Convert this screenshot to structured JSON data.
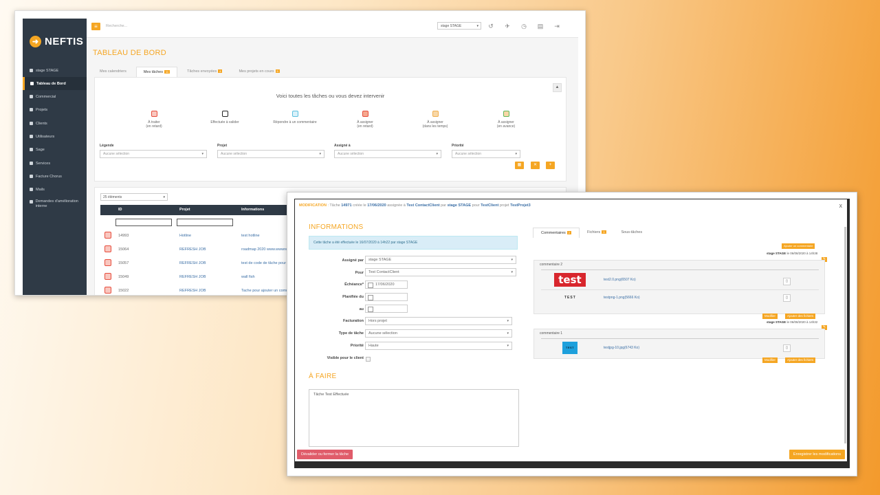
{
  "back": {
    "logo_mark": "➜",
    "logo": "NEFTIS",
    "search_placeholder": "Recherche...",
    "stage_select": "stage STAGE",
    "sidebar": [
      {
        "label": "stage STAGE",
        "icon": "user-icon"
      },
      {
        "label": "Tableau de Bord",
        "icon": "home-icon"
      },
      {
        "label": "Commercial",
        "icon": "briefcase-icon"
      },
      {
        "label": "Projets",
        "icon": "folder-icon"
      },
      {
        "label": "Clients",
        "icon": "users-icon"
      },
      {
        "label": "Utilisateurs",
        "icon": "user-icon"
      },
      {
        "label": "Sage",
        "icon": "tag-icon"
      },
      {
        "label": "Services",
        "icon": "gear-icon"
      },
      {
        "label": "Facture Chorus",
        "icon": "invoice-icon"
      },
      {
        "label": "Mails",
        "icon": "mail-icon"
      },
      {
        "label": "Demandes d'amélioration interne",
        "icon": "list-icon"
      }
    ],
    "page_title": "TABLEAU DE BORD",
    "tabs": [
      {
        "label": "Mes calendriers",
        "badge": ""
      },
      {
        "label": "Mes tâches",
        "badge": "11"
      },
      {
        "label": "Tâches envoyées",
        "badge": "4"
      },
      {
        "label": "Mes projets en cours",
        "badge": "5"
      }
    ],
    "intro": "Voici toutes les tâches ou vous devez intervenir",
    "legend": [
      {
        "line1": "À traiter",
        "line2": "(en retard)",
        "color": "#e74c3c",
        "fill": "#f9c7bf"
      },
      {
        "line1": "Effectuée à valider",
        "line2": "",
        "color": "#222222",
        "fill": "#ffffff"
      },
      {
        "line1": "Répondre à un commentaire",
        "line2": "",
        "color": "#5bc0de",
        "fill": "#d9f1fa"
      },
      {
        "line1": "À assigner",
        "line2": "(en retard)",
        "color": "#e74c3c",
        "fill": "#f5a88f"
      },
      {
        "line1": "À assigner",
        "line2": "(dans les temps)",
        "color": "#f0ad4e",
        "fill": "#f8d7a6"
      },
      {
        "line1": "À assigner",
        "line2": "(en avance)",
        "color": "#5cb85c",
        "fill": "#f8d7a6"
      }
    ],
    "filters": [
      {
        "label": "Légende",
        "value": "Aucune sélection"
      },
      {
        "label": "Projet",
        "value": "Aucune sélection"
      },
      {
        "label": "Assigné à",
        "value": "Aucune sélection"
      },
      {
        "label": "Priorité",
        "value": "Aucune sélection"
      }
    ],
    "count": "25 éléments",
    "columns": [
      "ID",
      "Projet",
      "Informations"
    ],
    "rows": [
      {
        "id": "14993",
        "projet": "Hotline",
        "info": "test hotline"
      },
      {
        "id": "15064",
        "projet": "REFRESH JOB",
        "info": "roadmap 2020 www.wwwreal"
      },
      {
        "id": "15057",
        "projet": "REFRESH JOB",
        "info": "test de code de tâche pour le"
      },
      {
        "id": "15049",
        "projet": "REFRESH JOB",
        "info": "wall fish"
      },
      {
        "id": "15022",
        "projet": "REFRESH JOB",
        "info": "Tache pour ajouter un commentaire"
      }
    ]
  },
  "modal": {
    "header": {
      "mode": "MODIFICATION",
      "sep": ":",
      "t1": "Tâche",
      "task_id": "14971",
      "t2": "créée le",
      "created": "17/06/2020",
      "t3": "assignée à",
      "assignee": "Test ContactClient",
      "t4": "par",
      "by": "stage STAGE",
      "t5": "pour",
      "client": "TestClient",
      "t6": "projet",
      "project": "TestProjet3"
    },
    "close": "x",
    "info_title": "INFORMATIONS",
    "info_box": "Cette tâche a été effectuée le 16/07/2020 à 14h22 par stage STAGE",
    "fields": {
      "assigne_label": "Assigné par",
      "assigne_value": "stage STAGE",
      "pour_label": "Pour",
      "pour_value": "Test ContactClient",
      "echeance_label": "Échéance*",
      "echeance_value": "17/06/2020",
      "planifiee_label": "Planifiée du",
      "au_label": "au",
      "facturation_label": "Facturation",
      "facturation_value": "Hors projet",
      "type_label": "Type de tâche",
      "type_value": "Aucune sélection",
      "priorite_label": "Priorité",
      "priorite_value": "Haute",
      "visible_label": "Visible pour le client"
    },
    "todo_title": "À FAIRE",
    "todo_text": "Tâche Test Effectuée",
    "btn_devalider": "Dévalider ou fermer la tâche",
    "btn_save": "Enregistrer les modifications",
    "tabs": [
      {
        "label": "Commentaires",
        "badge": "2"
      },
      {
        "label": "Fichiers",
        "badge": "3"
      },
      {
        "label": "Sous-tâches",
        "badge": ""
      }
    ],
    "add_comment": "Ajouter un commentaire",
    "comments": [
      {
        "meta_by": "stage STAGE",
        "meta_date": "le 06/08/2020 à 14h38",
        "title": "commentaire 2",
        "files": [
          {
            "thumb": "test",
            "name": "test2.0.png(6507 Ko)"
          },
          {
            "thumb": "TEST",
            "name": "testpng-1.png(5666 Ko)"
          }
        ],
        "btn_edit": "Modifier",
        "btn_add": "Ajouter des fichiers"
      },
      {
        "meta_by": "stage STAGE",
        "meta_date": "le 06/08/2020 à 14h32",
        "title": "commentaire 1",
        "files": [
          {
            "thumb": "TEST",
            "name": "testjpg-10.jpg(6743 Ko)"
          }
        ],
        "btn_edit": "Modifier",
        "btn_add": "Ajouter des fichiers"
      }
    ]
  }
}
